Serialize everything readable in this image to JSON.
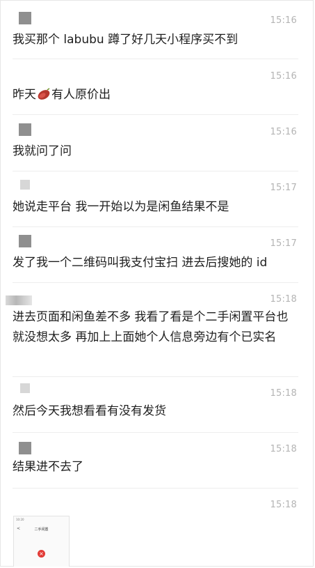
{
  "messages": [
    {
      "time": "15:16",
      "text": "我买那个 labubu 蹲了好几天小程序买不到"
    },
    {
      "time": "15:16",
      "text_before": "昨天",
      "emoji": "sweet-potato-icon",
      "text_after": "有人原价出"
    },
    {
      "time": "15:16",
      "text": "我就问了问"
    },
    {
      "time": "15:17",
      "text": "她说走平台 我一开始以为是闲鱼结果不是"
    },
    {
      "time": "15:17",
      "text": "发了我一个二维码叫我支付宝扫 进去后搜她的 id"
    },
    {
      "time": "15:18",
      "text": "进去页面和闲鱼差不多 我看了看是个二手闲置平台也就没想太多 再加上上面她个人信息旁边有个已实名"
    },
    {
      "time": "15:18",
      "text": "然后今天我想看看有没有发货"
    },
    {
      "time": "15:18",
      "text": "结果进不去了"
    },
    {
      "time": "15:18"
    }
  ],
  "thumbnail": {
    "status_time": "10:20",
    "title": "二手闲置",
    "back": "<",
    "error_icon": "×"
  },
  "colors": {
    "time": "#b4b4b4",
    "text": "#1e1e1e",
    "divider": "#ededed",
    "error": "#e23b36"
  }
}
